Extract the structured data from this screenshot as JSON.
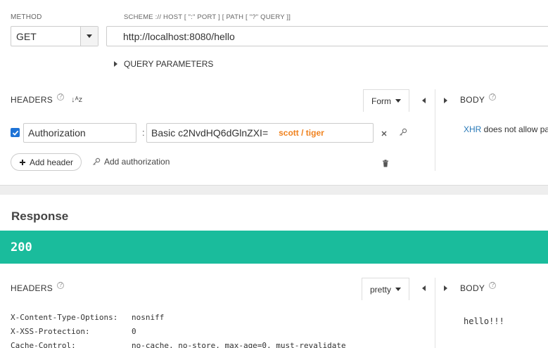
{
  "request": {
    "method_label": "METHOD",
    "method_value": "GET",
    "url_label": "SCHEME :// HOST [ \":\" PORT ] [ PATH [ \"?\" QUERY ]]",
    "url_value": "http://localhost:8080/hello",
    "query_params_label": "QUERY PARAMETERS"
  },
  "headers": {
    "title": "HEADERS",
    "help": "?",
    "sort_icon_text": "↓ᴬᴢ",
    "mode": "Form",
    "rows": [
      {
        "enabled": true,
        "name": "Authorization",
        "separator": ":",
        "value": "Basic c2NvdHQ6dGlnZXI=",
        "hint": "scott / tiger"
      }
    ],
    "add_header_label": "Add header",
    "add_auth_label": "Add authorization"
  },
  "body": {
    "title": "BODY",
    "help": "?",
    "xhr_link": "XHR",
    "xhr_text": " does not allow pa"
  },
  "response": {
    "title": "Response",
    "status_code": "200",
    "status_color": "#1abc9c",
    "headers_title": "HEADERS",
    "help": "?",
    "mode": "pretty",
    "body_title": "BODY",
    "body_text": "hello!!!",
    "header_rows": [
      {
        "name": "X-Content-Type-Options:",
        "value": "nosniff"
      },
      {
        "name": "X-XSS-Protection:",
        "value": "0"
      },
      {
        "name": "Cache-Control:",
        "value": "no-cache, no-store, max-age=0, must-revalidate"
      }
    ]
  }
}
